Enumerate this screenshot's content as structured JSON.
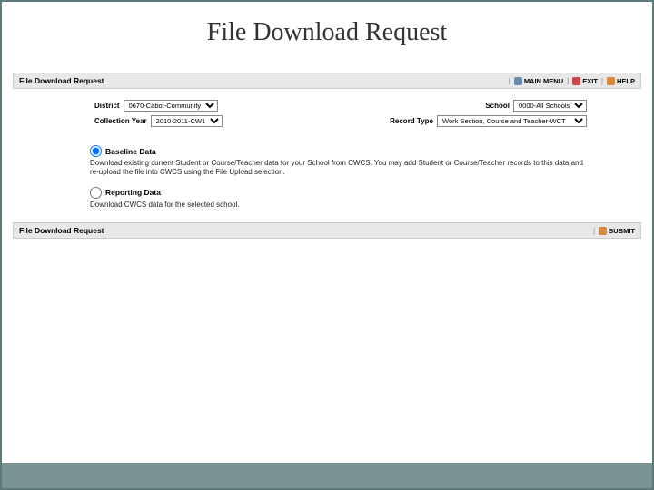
{
  "title": "File Download Request",
  "topbar": {
    "label": "File Download Request",
    "links": {
      "mainmenu": "MAIN MENU",
      "exit": "EXIT",
      "help": "HELP"
    }
  },
  "form": {
    "district": {
      "label": "District",
      "value": "0670-Cabot-Community"
    },
    "school": {
      "label": "School",
      "value": "0000-All Schools"
    },
    "collection_year": {
      "label": "Collection Year",
      "value": "2010-2011-CW1"
    },
    "record_type": {
      "label": "Record Type",
      "value": "Work Section, Course and Teacher-WCT"
    }
  },
  "options": {
    "baseline": {
      "label": "Baseline Data",
      "desc": "Download existing current Student or Course/Teacher data for your School from CWCS. You may add Student or Course/Teacher records to this data and re-upload the file into CWCS using the File Upload selection."
    },
    "reporting": {
      "label": "Reporting Data",
      "desc": "Download CWCS data for the selected school."
    }
  },
  "submitbar": {
    "label": "File Download Request",
    "submit": "SUBMIT"
  }
}
